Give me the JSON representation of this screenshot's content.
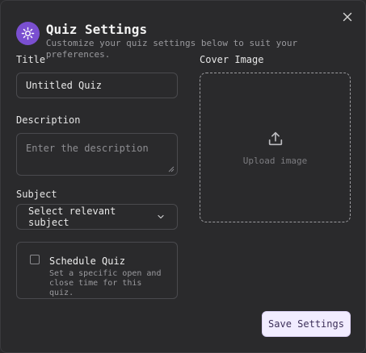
{
  "dialog": {
    "title": "Quiz Settings",
    "subtitle": "Customize your quiz settings below to suit your preferences.",
    "logo_icon": "gear-sparkle-icon",
    "accent_color": "#7a4fd0"
  },
  "form": {
    "title_label": "Title",
    "title_value": "Untitled Quiz",
    "description_label": "Description",
    "description_placeholder": "Enter the description",
    "subject_label": "Subject",
    "subject_value": "Select relevant subject",
    "schedule_title": "Schedule Quiz",
    "schedule_description": "Set a specific open and close time for this quiz.",
    "schedule_checked": false
  },
  "cover": {
    "label": "Cover Image",
    "upload_text": "Upload image",
    "upload_icon": "upload-icon"
  },
  "actions": {
    "save_label": "Save Settings",
    "close_icon": "close-icon"
  }
}
